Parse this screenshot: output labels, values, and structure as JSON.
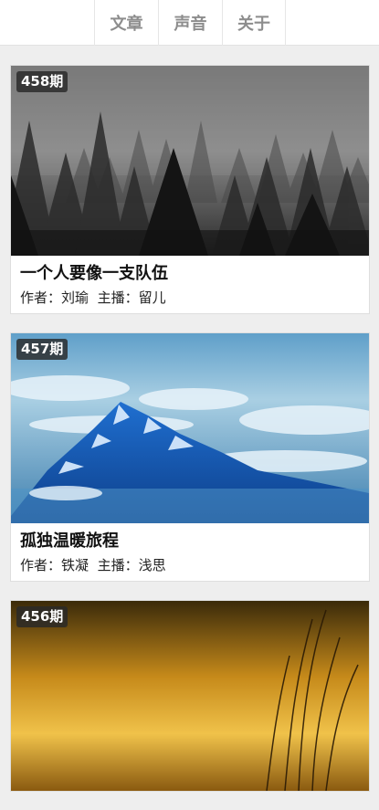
{
  "nav": {
    "tabs": [
      {
        "label": "文章"
      },
      {
        "label": "声音"
      },
      {
        "label": "关于"
      }
    ]
  },
  "episodes": [
    {
      "issue": "458期",
      "title": "一个人要像一支队伍",
      "author_label": "作者：",
      "author": "刘瑜",
      "host_label": "主播：",
      "host": "留儿",
      "cover": "misty-pine-forest"
    },
    {
      "issue": "457期",
      "title": "孤独温暖旅程",
      "author_label": "作者：",
      "author": "铁凝",
      "host_label": "主播：",
      "host": "浅思",
      "cover": "blue-mountain-clouds"
    },
    {
      "issue": "456期",
      "cover": "golden-sunset-grass"
    }
  ],
  "colors": {
    "background": "#eeeeee",
    "tab_text": "#8d8d8d",
    "title_text": "#111111"
  }
}
